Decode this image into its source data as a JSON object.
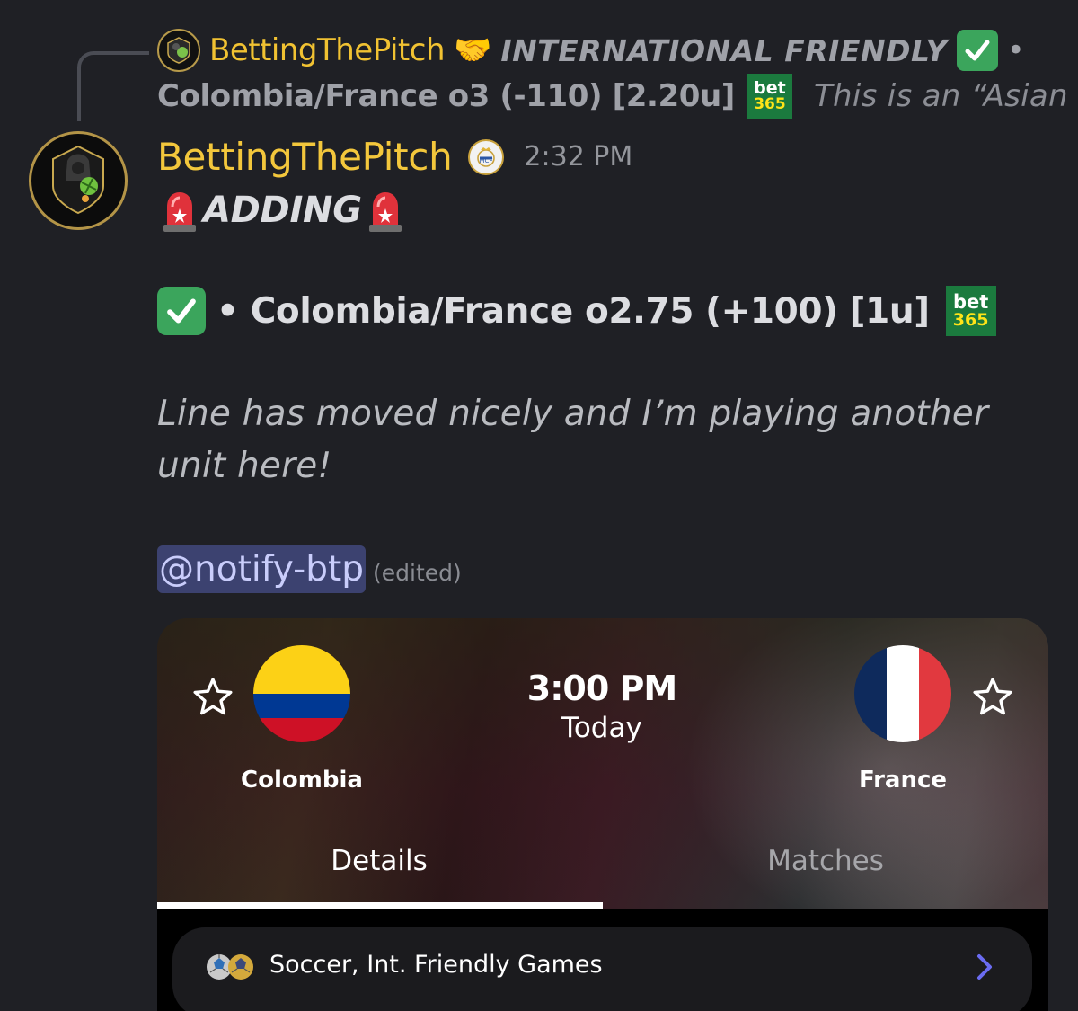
{
  "reply": {
    "author": "BettingThePitch",
    "handshake_emoji": "🤝",
    "title": "INTERNATIONAL FRIENDLY",
    "bullet": "•",
    "bet": "Colombia/France o3 (-110) [2.20u]",
    "preview": "This is an “Asian …"
  },
  "message": {
    "author": "BettingThePitch",
    "timestamp": "2:32 PM",
    "header_text": "ADDING",
    "bet_line": "• Colombia/France o2.75 (+100) [1u]",
    "comment": "Line has moved nicely and I’m playing another unit here!",
    "mention": "@notify-btp",
    "edited": "(edited)"
  },
  "bet365": {
    "top": "bet",
    "bottom": "365"
  },
  "card": {
    "home_team": "Colombia",
    "away_team": "France",
    "time": "3:00 PM",
    "day": "Today",
    "tabs": [
      {
        "label": "Details",
        "active": true
      },
      {
        "label": "Matches",
        "active": false
      }
    ],
    "league": "Soccer, Int. Friendly Games"
  },
  "colors": {
    "author": "#f3c73c",
    "check": "#3ba55c",
    "mention_bg": "#3c4270",
    "bet365_green": "#1b7a3e",
    "chevron": "#6b6cf2"
  },
  "icons": [
    "reply-curve",
    "avatar",
    "handshake-icon",
    "check-icon",
    "bet365-logo",
    "club-badge-icon",
    "siren-icon",
    "star-icon",
    "colombia-flag",
    "france-flag",
    "soccer-balls-icon",
    "chevron-right-icon"
  ]
}
